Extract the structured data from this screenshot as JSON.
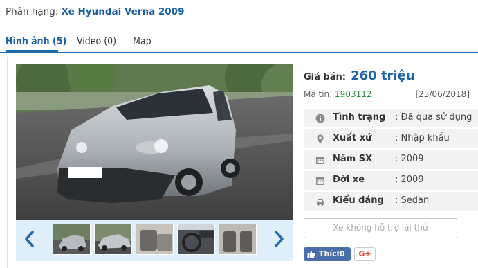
{
  "category": {
    "label": "Phân hạng:",
    "value": "Xe Hyundai Verna 2009"
  },
  "tabs": [
    {
      "label": "Hình ảnh (5)",
      "active": true
    },
    {
      "label": "Video (0)",
      "active": false
    },
    {
      "label": "Map",
      "active": false
    }
  ],
  "gallery": {
    "main_image": "silver-hatchback-car-photo",
    "plate_text": "",
    "thumbnails": [
      "car-front-thumb",
      "car-side-thumb",
      "car-interior-thumb",
      "car-dashboard-thumb",
      "car-seats-thumb"
    ],
    "prev_icon": "chevron-left-icon",
    "next_icon": "chevron-right-icon",
    "strip_color": "#dfeff9"
  },
  "listing": {
    "price_label": "Giá bán:",
    "price_value": "260 triệu",
    "code_label": "Mã tin:",
    "code_value": "1903112",
    "date": "[25/06/2018]"
  },
  "specs": [
    {
      "icon": "info-icon",
      "label": "Tình trạng",
      "value": ": Đã qua sử dụng"
    },
    {
      "icon": "map-pin-icon",
      "label": "Xuất xứ",
      "value": ": Nhập khẩu"
    },
    {
      "icon": "calendar-icon",
      "label": "Năm SX",
      "value": ": 2009"
    },
    {
      "icon": "calendar-icon",
      "label": "Đời xe",
      "value": ": 2009"
    },
    {
      "icon": "car-icon",
      "label": "Kiểu dáng",
      "value": ": Sedan"
    }
  ],
  "actions": {
    "no_trade_label": "Xe không hỗ trợ lái thử",
    "like_label": "Thích",
    "like_count": "0",
    "gplus_label": "G+"
  },
  "colors": {
    "accent": "#1f64a8",
    "code_green": "#2e8b3d",
    "facebook": "#4a6ea9",
    "gplus": "#dd4b39"
  }
}
